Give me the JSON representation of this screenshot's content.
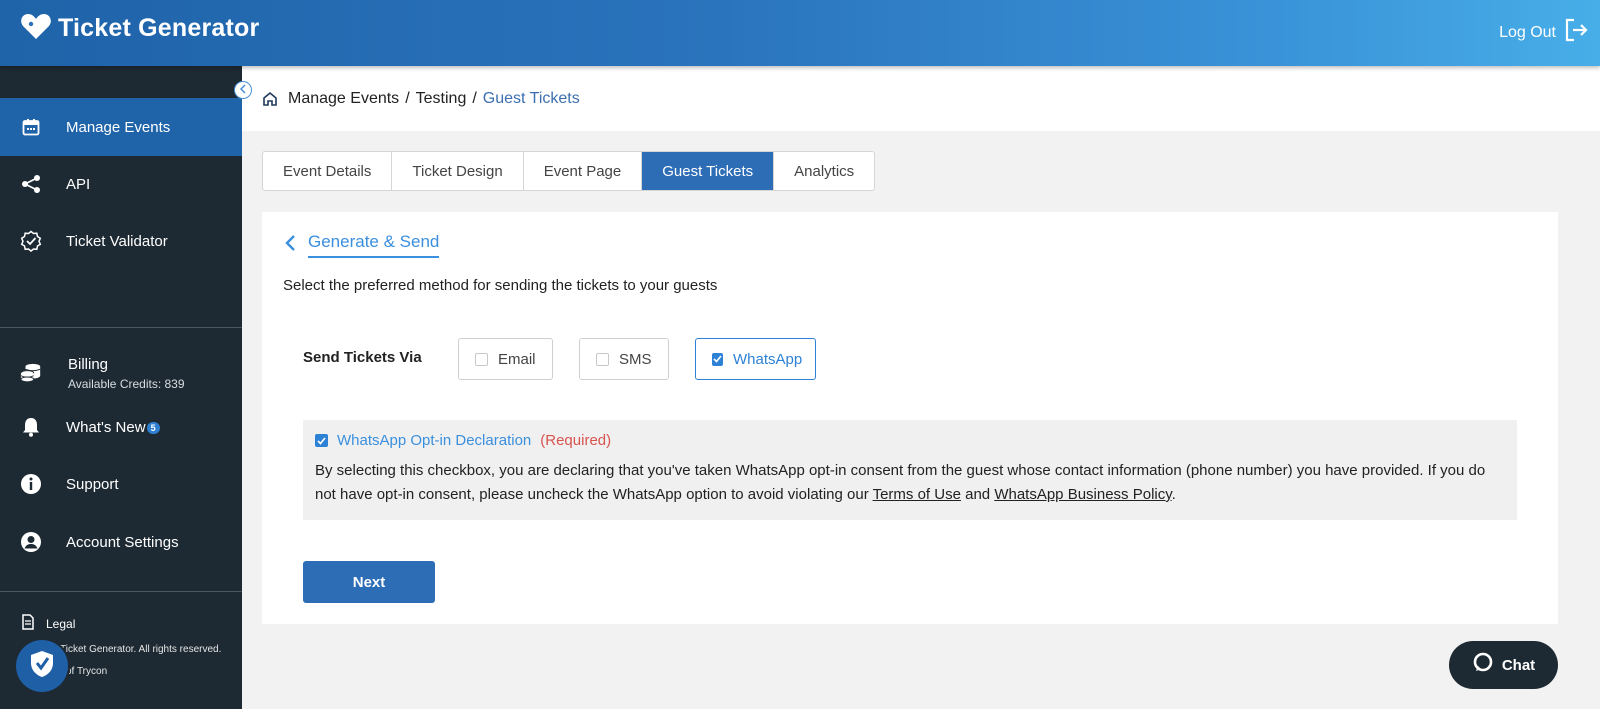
{
  "header": {
    "brand": "Ticket Generator",
    "logout_label": "Log Out"
  },
  "sidebar": {
    "items": [
      {
        "label": "Manage Events",
        "icon": "calendar-icon",
        "active": true
      },
      {
        "label": "API",
        "icon": "share-nodes-icon"
      },
      {
        "label": "Ticket Validator",
        "icon": "badge-check-icon"
      }
    ],
    "billing": {
      "label": "Billing",
      "credits": "Available Credits: 839",
      "icon": "coins-icon"
    },
    "whats_new": {
      "label": "What's New",
      "badge": "5",
      "icon": "bell-icon"
    },
    "support": {
      "label": "Support",
      "icon": "info-icon"
    },
    "account": {
      "label": "Account Settings",
      "icon": "user-circle-icon"
    },
    "legal": "Legal",
    "copyright": "Ticket Generator. All rights reserved.",
    "company": "of Trycon"
  },
  "breadcrumb": {
    "items": [
      "Manage Events",
      "Testing"
    ],
    "current": "Guest Tickets"
  },
  "tabs": [
    {
      "label": "Event Details"
    },
    {
      "label": "Ticket Design"
    },
    {
      "label": "Event Page"
    },
    {
      "label": "Guest Tickets",
      "active": true
    },
    {
      "label": "Analytics"
    }
  ],
  "card": {
    "title": "Generate & Send",
    "intro": "Select the preferred method for sending the tickets to your guests",
    "send_label": "Send Tickets Via",
    "options": [
      {
        "label": "Email",
        "checked": false
      },
      {
        "label": "SMS",
        "checked": false
      },
      {
        "label": "WhatsApp",
        "checked": true
      }
    ],
    "declaration": {
      "title": "WhatsApp Opt-in Declaration",
      "required": "(Required)",
      "checked": true,
      "body_pre": "By selecting this checkbox, you are declaring that you've taken WhatsApp opt-in consent from the guest whose contact information (phone number) you have provided. If you do not have opt-in consent, please uncheck the WhatsApp option to avoid violating our ",
      "terms_link": "Terms of Use",
      "and": " and ",
      "policy_link": "WhatsApp Business Policy",
      "end": "."
    },
    "next_label": "Next"
  },
  "chat": {
    "label": "Chat"
  },
  "colors": {
    "primary": "#2c6db5",
    "link": "#3a8fde",
    "sidebar_bg": "#1e2a33",
    "required": "#d9534f"
  }
}
